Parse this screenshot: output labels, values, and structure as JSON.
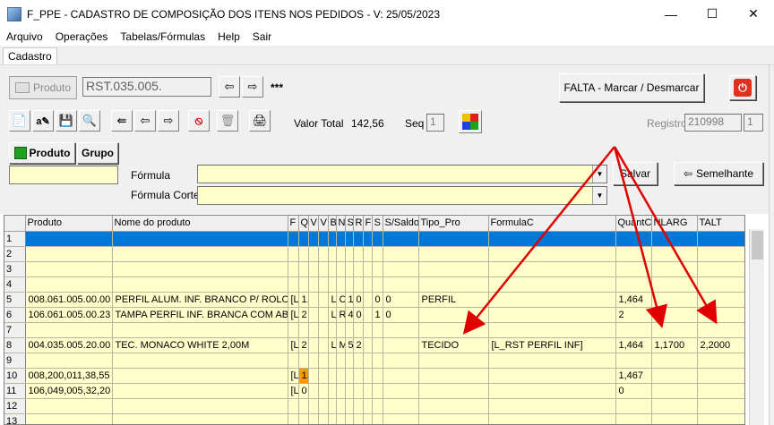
{
  "window": {
    "title": "F_PPE - CADASTRO DE COMPOSIÇÃO DOS ITENS NOS PEDIDOS - V: 25/05/2023",
    "minimize": "—",
    "maximize": "☐",
    "close": "✕"
  },
  "menu": [
    "Arquivo",
    "Operações",
    "Tabelas/Fórmulas",
    "Help",
    "Sair"
  ],
  "tab": "Cadastro",
  "toolbar1": {
    "produto_button": "Produto",
    "code_value": "RST.035.005.",
    "stars": "***",
    "falta_button": "FALTA - Marcar / Desmarcar"
  },
  "toolbar2": {
    "valor_total_label": "Valor Total",
    "valor_total_value": "142,56",
    "seq_label": "Seq",
    "seq_value": "1",
    "registro_label": "Registro",
    "registro_value": "210998",
    "registro_sub": "1"
  },
  "filter": {
    "produto_button": "Produto",
    "grupo_button": "Grupo",
    "formula_label": "Fórmula",
    "formula_corte_label": "Fórmula Corte",
    "salvar_button": "Salvar",
    "semelhante_button": "Semelhante"
  },
  "grid": {
    "columns": [
      "Produto",
      "Nome do produto",
      "F",
      "Q",
      "V",
      "V",
      "B",
      "N",
      "S",
      "R",
      "F",
      "S",
      "S/Saldo",
      "Tipo_Pro",
      "FormulaC",
      "QuantC",
      "NLARG",
      "TALT"
    ],
    "rows": [
      {
        "n": "1",
        "cells": [
          "",
          "",
          "",
          "",
          "",
          "",
          "",
          "",
          "",
          "",
          "",
          "",
          "",
          "",
          "",
          "",
          "",
          ""
        ]
      },
      {
        "n": "2",
        "cells": [
          "",
          "",
          "",
          "",
          "",
          "",
          "",
          "",
          "",
          "",
          "",
          "",
          "",
          "",
          "",
          "",
          "",
          ""
        ]
      },
      {
        "n": "3",
        "cells": [
          "",
          "",
          "",
          "",
          "",
          "",
          "",
          "",
          "",
          "",
          "",
          "",
          "",
          "",
          "",
          "",
          "",
          ""
        ]
      },
      {
        "n": "4",
        "cells": [
          "",
          "",
          "",
          "",
          "",
          "",
          "",
          "",
          "",
          "",
          "",
          "",
          "",
          "",
          "",
          "",
          "",
          ""
        ]
      },
      {
        "n": "5",
        "cells": [
          "008.061.005.00.00",
          "PERFIL ALUM. INF. BRANCO P/ ROLO",
          "[L",
          "1,",
          "",
          "",
          "L",
          "C",
          "1",
          "0",
          "",
          "0",
          "0",
          "PERFIL",
          "",
          "1,464",
          "",
          ""
        ]
      },
      {
        "n": "6",
        "cells": [
          "106.061.005.00.23",
          "TAMPA PERFIL INF. BRANCA COM AB",
          "[L",
          "2",
          "",
          "",
          "L",
          "R",
          "4",
          "0",
          "",
          "1",
          "0",
          "",
          "",
          "2",
          "",
          ""
        ]
      },
      {
        "n": "7",
        "cells": [
          "",
          "",
          "",
          "",
          "",
          "",
          "",
          "",
          "",
          "",
          "",
          "",
          "",
          "",
          "",
          "",
          "",
          ""
        ]
      },
      {
        "n": "8",
        "cells": [
          "004.035.005.20.00",
          "TEC. MONACO WHITE 2,00M",
          "[L",
          "2",
          "",
          "",
          "L",
          "M",
          "5",
          "2",
          "",
          "",
          "",
          "TECIDO",
          "[L_RST PERFIL INF]",
          "1,464",
          "1,1700",
          "2,2000"
        ]
      },
      {
        "n": "9",
        "cells": [
          "",
          "",
          "",
          "",
          "",
          "",
          "",
          "",
          "",
          "",
          "",
          "",
          "",
          "",
          "",
          "",
          "",
          ""
        ]
      },
      {
        "n": "10",
        "cells": [
          "008,200,011,38,55",
          "",
          "[L",
          "1,",
          "",
          "",
          "",
          "",
          "",
          "",
          "",
          "",
          "",
          "",
          "",
          "1,467",
          "",
          ""
        ]
      },
      {
        "n": "11",
        "cells": [
          "106,049,005,32,20",
          "",
          "[L",
          "0",
          "",
          "",
          "",
          "",
          "",
          "",
          "",
          "",
          "",
          "",
          "",
          "0",
          "",
          ""
        ]
      },
      {
        "n": "12",
        "cells": [
          "",
          "",
          "",
          "",
          "",
          "",
          "",
          "",
          "",
          "",
          "",
          "",
          "",
          "",
          "",
          "",
          "",
          ""
        ]
      },
      {
        "n": "13",
        "cells": [
          "",
          "",
          "",
          "",
          "",
          "",
          "",
          "",
          "",
          "",
          "",
          "",
          "",
          "",
          "",
          "",
          "",
          ""
        ]
      }
    ]
  },
  "colors": {
    "arrow": "#e00000",
    "grid_bg": "#ffffcc",
    "selected": "#0078d7",
    "highlight": "#ff9900"
  }
}
